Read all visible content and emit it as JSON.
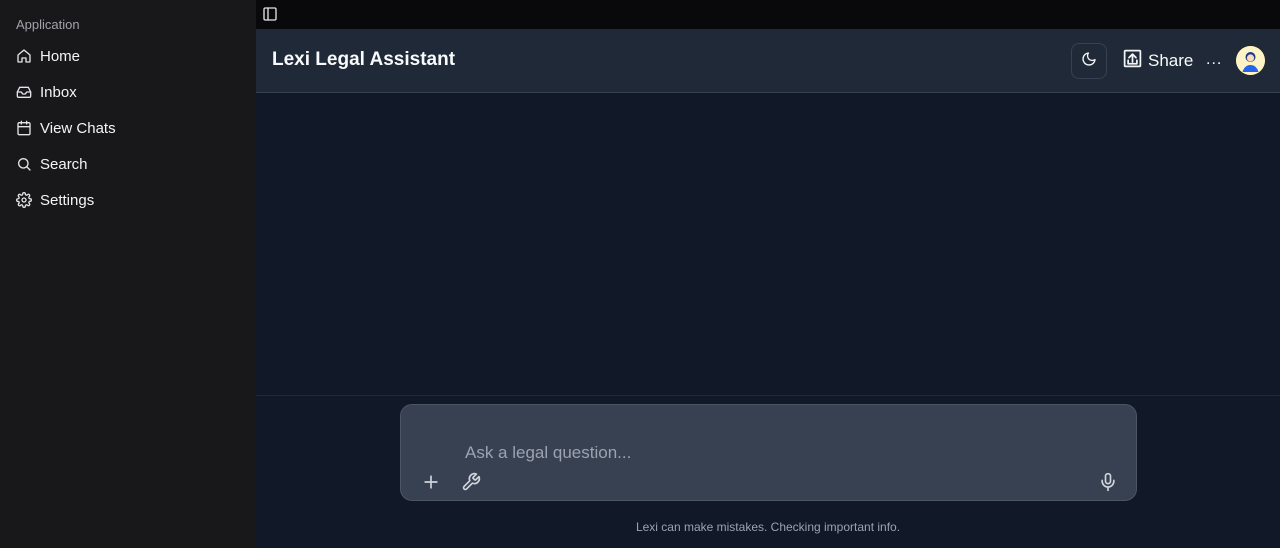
{
  "sidebar": {
    "group_label": "Application",
    "items": [
      {
        "label": "Home",
        "icon": "home-icon"
      },
      {
        "label": "Inbox",
        "icon": "inbox-icon"
      },
      {
        "label": "View Chats",
        "icon": "calendar-icon"
      },
      {
        "label": "Search",
        "icon": "search-icon"
      },
      {
        "label": "Settings",
        "icon": "gear-icon"
      }
    ]
  },
  "header": {
    "title": "Lexi Legal Assistant",
    "share_label": "Share",
    "more_label": "..."
  },
  "composer": {
    "placeholder": "Ask a legal question...",
    "value": ""
  },
  "footer": {
    "disclaimer": "Lexi can make mistakes. Checking important info."
  },
  "colors": {
    "sidebar_bg": "#18181b",
    "main_bg": "#111827",
    "header_bg": "#1f2937",
    "composer_bg": "#374151"
  }
}
